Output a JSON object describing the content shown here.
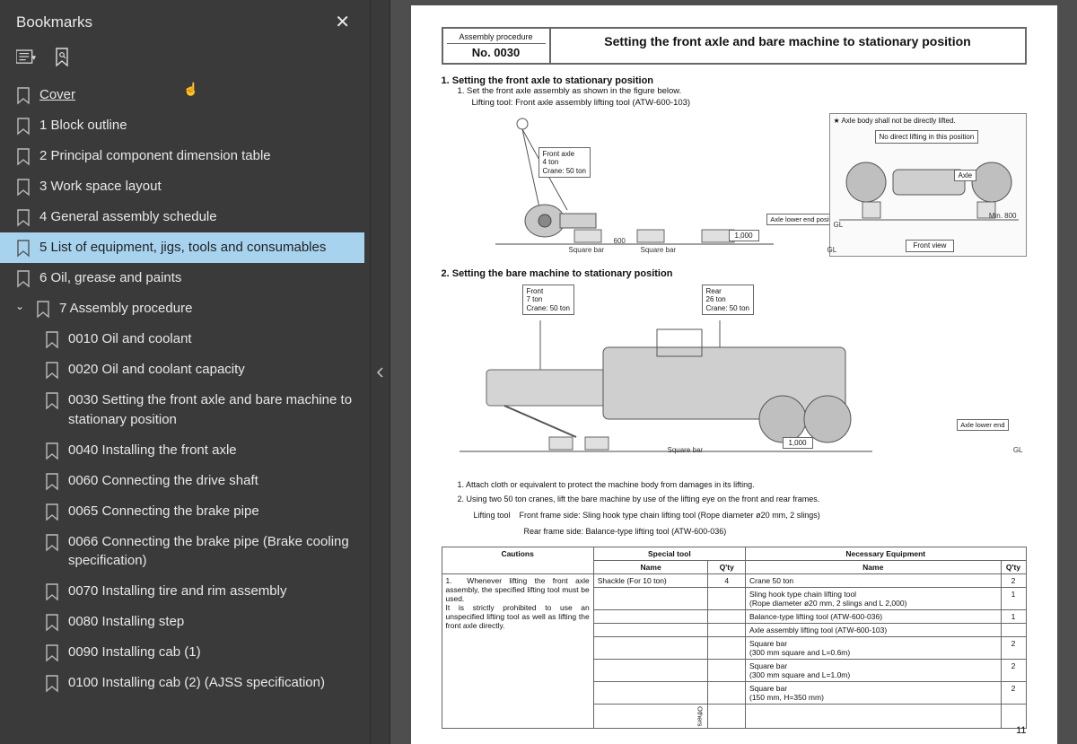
{
  "sidebar": {
    "title": "Bookmarks",
    "items": [
      {
        "label": "Cover",
        "underline": true
      },
      {
        "label": "1 Block outline"
      },
      {
        "label": "2 Principal component dimension table"
      },
      {
        "label": "3 Work space layout"
      },
      {
        "label": "4 General assembly schedule"
      },
      {
        "label": "5 List of equipment, jigs, tools and consumables",
        "selected": true
      },
      {
        "label": "6 Oil, grease and paints"
      },
      {
        "label": "7 Assembly procedure",
        "expanded": true,
        "children": [
          {
            "label": "0010 Oil and coolant"
          },
          {
            "label": "0020 Oil and coolant capacity"
          },
          {
            "label": "0030 Setting the front axle and bare machine to stationary position"
          },
          {
            "label": "0040 Installing the front axle"
          },
          {
            "label": "0060 Connecting the drive shaft"
          },
          {
            "label": "0065 Connecting the brake pipe"
          },
          {
            "label": "0066 Connecting the brake pipe (Brake cooling specification)"
          },
          {
            "label": "0070 Installing tire and rim assembly"
          },
          {
            "label": "0080 Installing step"
          },
          {
            "label": "0090 Installing cab (1)"
          },
          {
            "label": "0100 Installing cab (2) (AJSS specification)"
          }
        ]
      }
    ]
  },
  "doc": {
    "header": {
      "ap": "Assembly procedure",
      "no": "No. 0030",
      "title": "Setting the front axle and bare machine to stationary position"
    },
    "sec1": {
      "title": "1.  Setting the front axle to stationary position",
      "line1": "1.   Set the front axle assembly as shown in the figure below.",
      "line2": "Lifting tool: Front axle assembly lifting tool (ATW-600-103)",
      "callout_axle": "Front axle\n4 ton\nCrane: 50 ton",
      "sqbar": "Square bar",
      "dim_600": "600",
      "dim_1000": "1,000",
      "gl": "GL",
      "front_notes": {
        "warn": "★ Axle body shall not be directly lifted.",
        "box": "No direct lifting in this position",
        "axle": "Axle",
        "min800": "Min. 800",
        "frontview": "Front view",
        "axle_lower": "Axle lower end position"
      }
    },
    "sec2": {
      "title": "2.  Setting the bare machine to stationary position",
      "front_box": "Front\n7 ton\nCrane: 50 ton",
      "rear_box": "Rear\n26 ton\nCrane: 50 ton",
      "sqbar": "Square bar",
      "dim_1000": "1,000",
      "axle_lower_end": "Axle lower end",
      "gl": "GL"
    },
    "notes": {
      "n1": "1.   Attach cloth or equivalent to protect the machine body from damages in its lifting.",
      "n2": "2.   Using two 50 ton cranes, lift the bare machine by use of the lifting eye on the front and rear frames.",
      "lt": "Lifting tool",
      "lt1": "Front frame side: Sling hook type chain lifting tool (Rope diameter ø20 mm, 2 slings)",
      "lt2": "Rear frame side:  Balance-type lifting tool (ATW-600-036)"
    },
    "table": {
      "h_cautions": "Cautions",
      "h_special": "Special tool",
      "h_equip": "Necessary Equipment",
      "h_name": "Name",
      "h_qty": "Q'ty",
      "caution": "1.  Whenever lifting the front axle assembly, the specified lifting tool must be used.\nIt is strictly prohibited to use an unspecified lifting tool as well as lifting the front axle directly.",
      "special": [
        {
          "name": "Shackle (For 10 ton)",
          "qty": "4"
        }
      ],
      "equip": [
        {
          "name": "Crane 50 ton",
          "qty": "2"
        },
        {
          "name": "Sling hook type chain lifting tool\n(Rope diameter ø20 mm, 2 slings and L 2,000)",
          "qty": "1"
        },
        {
          "name": "Balance-type lifting tool (ATW-600-036)",
          "qty": "1"
        },
        {
          "name": "Axle assembly lifting tool (ATW-600-103)",
          "qty": ""
        },
        {
          "name": "Square bar\n(300 mm square and L=0.6m)",
          "qty": "2"
        },
        {
          "name": "Square bar\n(300 mm square and L=1.0m)",
          "qty": "2"
        },
        {
          "name": "Square bar\n(150 mm, H=350 mm)",
          "qty": "2"
        }
      ],
      "others": "Others"
    },
    "page_number": "11"
  }
}
